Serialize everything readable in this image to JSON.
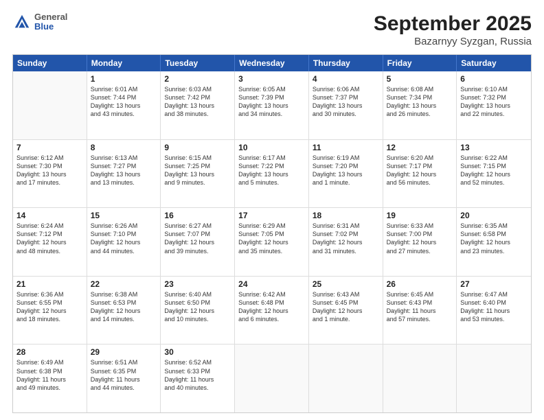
{
  "header": {
    "logo_general": "General",
    "logo_blue": "Blue",
    "month_title": "September 2025",
    "location": "Bazarnyy Syzgan, Russia"
  },
  "weekdays": [
    "Sunday",
    "Monday",
    "Tuesday",
    "Wednesday",
    "Thursday",
    "Friday",
    "Saturday"
  ],
  "rows": [
    [
      {
        "day": "",
        "lines": []
      },
      {
        "day": "1",
        "lines": [
          "Sunrise: 6:01 AM",
          "Sunset: 7:44 PM",
          "Daylight: 13 hours",
          "and 43 minutes."
        ]
      },
      {
        "day": "2",
        "lines": [
          "Sunrise: 6:03 AM",
          "Sunset: 7:42 PM",
          "Daylight: 13 hours",
          "and 38 minutes."
        ]
      },
      {
        "day": "3",
        "lines": [
          "Sunrise: 6:05 AM",
          "Sunset: 7:39 PM",
          "Daylight: 13 hours",
          "and 34 minutes."
        ]
      },
      {
        "day": "4",
        "lines": [
          "Sunrise: 6:06 AM",
          "Sunset: 7:37 PM",
          "Daylight: 13 hours",
          "and 30 minutes."
        ]
      },
      {
        "day": "5",
        "lines": [
          "Sunrise: 6:08 AM",
          "Sunset: 7:34 PM",
          "Daylight: 13 hours",
          "and 26 minutes."
        ]
      },
      {
        "day": "6",
        "lines": [
          "Sunrise: 6:10 AM",
          "Sunset: 7:32 PM",
          "Daylight: 13 hours",
          "and 22 minutes."
        ]
      }
    ],
    [
      {
        "day": "7",
        "lines": [
          "Sunrise: 6:12 AM",
          "Sunset: 7:30 PM",
          "Daylight: 13 hours",
          "and 17 minutes."
        ]
      },
      {
        "day": "8",
        "lines": [
          "Sunrise: 6:13 AM",
          "Sunset: 7:27 PM",
          "Daylight: 13 hours",
          "and 13 minutes."
        ]
      },
      {
        "day": "9",
        "lines": [
          "Sunrise: 6:15 AM",
          "Sunset: 7:25 PM",
          "Daylight: 13 hours",
          "and 9 minutes."
        ]
      },
      {
        "day": "10",
        "lines": [
          "Sunrise: 6:17 AM",
          "Sunset: 7:22 PM",
          "Daylight: 13 hours",
          "and 5 minutes."
        ]
      },
      {
        "day": "11",
        "lines": [
          "Sunrise: 6:19 AM",
          "Sunset: 7:20 PM",
          "Daylight: 13 hours",
          "and 1 minute."
        ]
      },
      {
        "day": "12",
        "lines": [
          "Sunrise: 6:20 AM",
          "Sunset: 7:17 PM",
          "Daylight: 12 hours",
          "and 56 minutes."
        ]
      },
      {
        "day": "13",
        "lines": [
          "Sunrise: 6:22 AM",
          "Sunset: 7:15 PM",
          "Daylight: 12 hours",
          "and 52 minutes."
        ]
      }
    ],
    [
      {
        "day": "14",
        "lines": [
          "Sunrise: 6:24 AM",
          "Sunset: 7:12 PM",
          "Daylight: 12 hours",
          "and 48 minutes."
        ]
      },
      {
        "day": "15",
        "lines": [
          "Sunrise: 6:26 AM",
          "Sunset: 7:10 PM",
          "Daylight: 12 hours",
          "and 44 minutes."
        ]
      },
      {
        "day": "16",
        "lines": [
          "Sunrise: 6:27 AM",
          "Sunset: 7:07 PM",
          "Daylight: 12 hours",
          "and 39 minutes."
        ]
      },
      {
        "day": "17",
        "lines": [
          "Sunrise: 6:29 AM",
          "Sunset: 7:05 PM",
          "Daylight: 12 hours",
          "and 35 minutes."
        ]
      },
      {
        "day": "18",
        "lines": [
          "Sunrise: 6:31 AM",
          "Sunset: 7:02 PM",
          "Daylight: 12 hours",
          "and 31 minutes."
        ]
      },
      {
        "day": "19",
        "lines": [
          "Sunrise: 6:33 AM",
          "Sunset: 7:00 PM",
          "Daylight: 12 hours",
          "and 27 minutes."
        ]
      },
      {
        "day": "20",
        "lines": [
          "Sunrise: 6:35 AM",
          "Sunset: 6:58 PM",
          "Daylight: 12 hours",
          "and 23 minutes."
        ]
      }
    ],
    [
      {
        "day": "21",
        "lines": [
          "Sunrise: 6:36 AM",
          "Sunset: 6:55 PM",
          "Daylight: 12 hours",
          "and 18 minutes."
        ]
      },
      {
        "day": "22",
        "lines": [
          "Sunrise: 6:38 AM",
          "Sunset: 6:53 PM",
          "Daylight: 12 hours",
          "and 14 minutes."
        ]
      },
      {
        "day": "23",
        "lines": [
          "Sunrise: 6:40 AM",
          "Sunset: 6:50 PM",
          "Daylight: 12 hours",
          "and 10 minutes."
        ]
      },
      {
        "day": "24",
        "lines": [
          "Sunrise: 6:42 AM",
          "Sunset: 6:48 PM",
          "Daylight: 12 hours",
          "and 6 minutes."
        ]
      },
      {
        "day": "25",
        "lines": [
          "Sunrise: 6:43 AM",
          "Sunset: 6:45 PM",
          "Daylight: 12 hours",
          "and 1 minute."
        ]
      },
      {
        "day": "26",
        "lines": [
          "Sunrise: 6:45 AM",
          "Sunset: 6:43 PM",
          "Daylight: 11 hours",
          "and 57 minutes."
        ]
      },
      {
        "day": "27",
        "lines": [
          "Sunrise: 6:47 AM",
          "Sunset: 6:40 PM",
          "Daylight: 11 hours",
          "and 53 minutes."
        ]
      }
    ],
    [
      {
        "day": "28",
        "lines": [
          "Sunrise: 6:49 AM",
          "Sunset: 6:38 PM",
          "Daylight: 11 hours",
          "and 49 minutes."
        ]
      },
      {
        "day": "29",
        "lines": [
          "Sunrise: 6:51 AM",
          "Sunset: 6:35 PM",
          "Daylight: 11 hours",
          "and 44 minutes."
        ]
      },
      {
        "day": "30",
        "lines": [
          "Sunrise: 6:52 AM",
          "Sunset: 6:33 PM",
          "Daylight: 11 hours",
          "and 40 minutes."
        ]
      },
      {
        "day": "",
        "lines": []
      },
      {
        "day": "",
        "lines": []
      },
      {
        "day": "",
        "lines": []
      },
      {
        "day": "",
        "lines": []
      }
    ]
  ]
}
